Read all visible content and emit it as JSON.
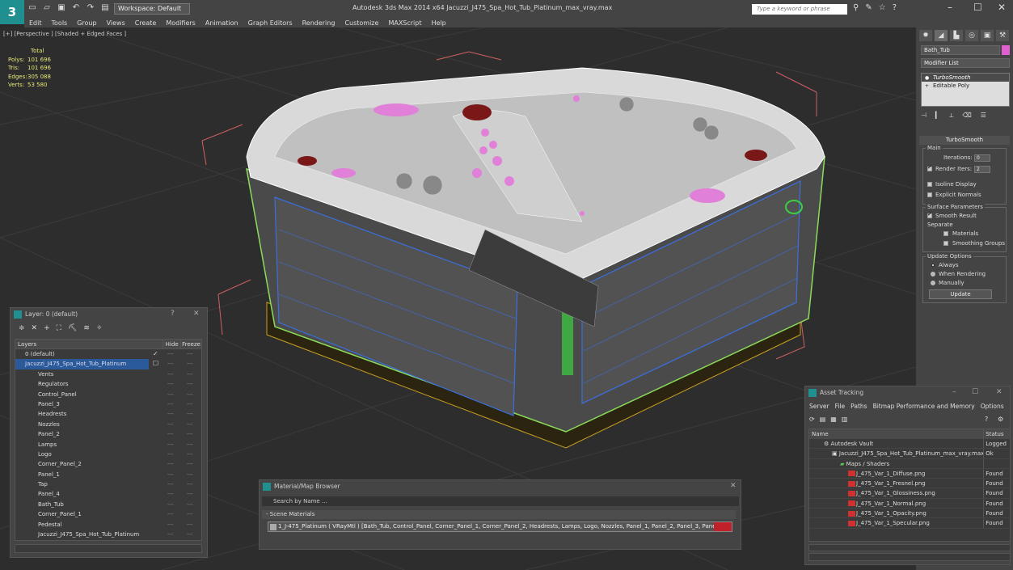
{
  "titlebar": {
    "workspace": "Workspace: Default",
    "title": "Autodesk 3ds Max  2014 x64      Jacuzzi_J475_Spa_Hot_Tub_Platinum_max_vray.max",
    "search_placeholder": "Type a keyword or phrase"
  },
  "menu": [
    "Edit",
    "Tools",
    "Group",
    "Views",
    "Create",
    "Modifiers",
    "Animation",
    "Graph Editors",
    "Rendering",
    "Customize",
    "MAXScript",
    "Help"
  ],
  "viewport": {
    "label": "[+] [Perspective ] [Shaded + Edged Faces ]",
    "stats": {
      "header": "Total",
      "rows": [
        {
          "k": "Polys:",
          "v": "101 696"
        },
        {
          "k": "Tris:",
          "v": "101 696"
        },
        {
          "k": "Edges:",
          "v": "305 088"
        },
        {
          "k": "Verts:",
          "v": "53 580"
        }
      ]
    }
  },
  "command_panel": {
    "object_name": "Bath_Tub",
    "object_color": "#e060d0",
    "modifier_list": "Modifier List",
    "stack": [
      "TurboSmooth",
      "Editable Poly"
    ],
    "rollout_title": "TurboSmooth",
    "main_group": "Main",
    "iterations_label": "Iterations:",
    "iterations_value": "0",
    "render_iters_label": "Render Iters:",
    "render_iters_value": "2",
    "isoline": "Isoline Display",
    "explicit_normals": "Explicit Normals",
    "surface_group": "Surface Parameters",
    "smooth_result": "Smooth Result",
    "separate": "Separate",
    "materials": "Materials",
    "smoothing_groups": "Smoothing Groups",
    "update_group": "Update Options",
    "always": "Always",
    "when_rendering": "When Rendering",
    "manually": "Manually",
    "update_button": "Update"
  },
  "layer_window": {
    "title": "Layer: 0 (default)",
    "help": "?",
    "columns": {
      "name": "Layers",
      "hide": "Hide",
      "freeze": "Freeze"
    },
    "rows": [
      "0 (default)",
      "Jacuzzi_J475_Spa_Hot_Tub_Platinum",
      "Vents",
      "Regulators",
      "Control_Panel",
      "Panel_3",
      "Headrests",
      "Nozzles",
      "Panel_2",
      "Lamps",
      "Logo",
      "Corner_Panel_2",
      "Panel_1",
      "Tap",
      "Panel_4",
      "Bath_Tub",
      "Corner_Panel_1",
      "Pedestal",
      "Jacuzzi_J475_Spa_Hot_Tub_Platinum"
    ]
  },
  "material_browser": {
    "title": "Material/Map Browser",
    "search": "Search by Name ...",
    "section": "- Scene Materials",
    "material": "1_J-475_Platinum  ( VRayMtl )  [Bath_Tub, Control_Panel, Corner_Panel_1, Corner_Panel_2, Headrests, Lamps, Logo, Nozzles, Panel_1, Panel_2, Panel_3, Panel_4, Ped..."
  },
  "asset_tracking": {
    "title": "Asset Tracking",
    "menu": [
      "Server",
      "File",
      "Paths",
      "Bitmap Performance and Memory",
      "Options"
    ],
    "columns": {
      "name": "Name",
      "status": "Status"
    },
    "rows": [
      {
        "name": "Autodesk Vault",
        "status": "Logged",
        "indent": 1
      },
      {
        "name": "Jacuzzi_J475_Spa_Hot_Tub_Platinum_max_vray.max",
        "status": "Ok",
        "indent": 2
      },
      {
        "name": "Maps / Shaders",
        "status": "",
        "indent": 3
      },
      {
        "name": "J_475_Var_1_Diffuse.png",
        "status": "Found",
        "indent": 4
      },
      {
        "name": "J_475_Var_1_Fresnel.png",
        "status": "Found",
        "indent": 4
      },
      {
        "name": "J_475_Var_1_Glossiness.png",
        "status": "Found",
        "indent": 4
      },
      {
        "name": "J_475_Var_1_Normal.png",
        "status": "Found",
        "indent": 4
      },
      {
        "name": "J_475_Var_1_Opacity.png",
        "status": "Found",
        "indent": 4
      },
      {
        "name": "J_475_Var_1_Specular.png",
        "status": "Found",
        "indent": 4
      }
    ]
  }
}
